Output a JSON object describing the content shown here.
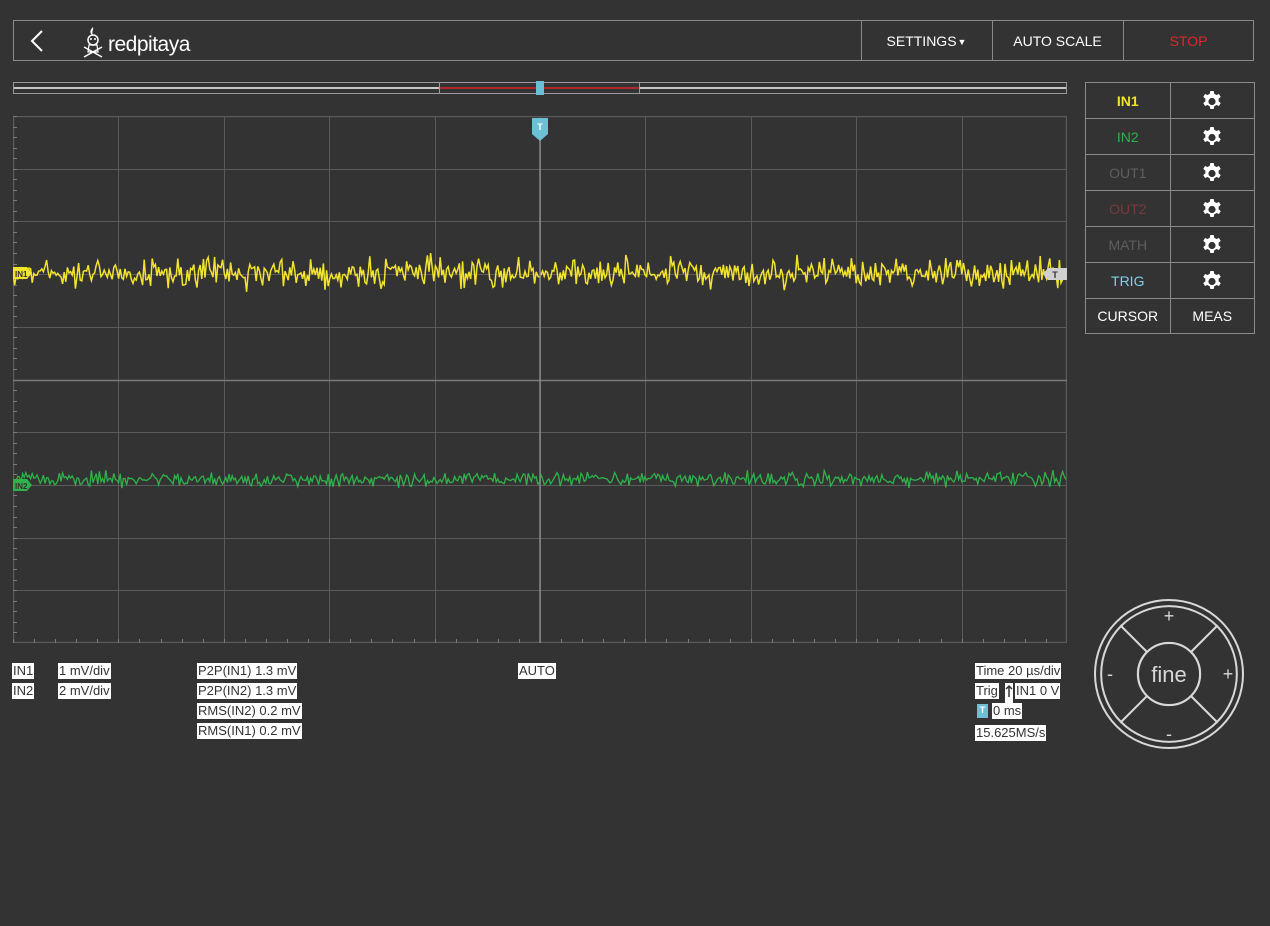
{
  "header": {
    "brand": "redpitaya",
    "settings_label": "SETTINGS",
    "autoscale_label": "AUTO SCALE",
    "stop_label": "STOP"
  },
  "plot": {
    "trigger_marker": "T",
    "in1_label": "IN1",
    "in2_label": "IN2",
    "trig_level_label": "T",
    "colors": {
      "in1": "#f2e32c",
      "in2": "#2fb14b",
      "trigger": "#6cc0d6",
      "grid": "#5a5a5a"
    }
  },
  "panel": {
    "rows": [
      {
        "label": "IN1",
        "color": "#f2e32c",
        "bold": true
      },
      {
        "label": "IN2",
        "color": "#2fb14b",
        "bold": false
      },
      {
        "label": "OUT1",
        "color": "#5e5e5e",
        "bold": false
      },
      {
        "label": "OUT2",
        "color": "#7a3a3a",
        "bold": false
      },
      {
        "label": "MATH",
        "color": "#5e5e5e",
        "bold": false
      },
      {
        "label": "TRIG",
        "color": "#7fd0e6",
        "bold": false
      }
    ],
    "cursor_label": "CURSOR",
    "meas_label": "MEAS"
  },
  "info": {
    "in1": "IN1",
    "in1_scale": "1 mV/div",
    "in2": "IN2",
    "in2_scale": "2 mV/div",
    "p2p_in1": "P2P(IN1) 1.3 mV",
    "p2p_in2": "P2P(IN2) 1.3 mV",
    "rms_in2": "RMS(IN2) 0.2 mV",
    "rms_in1": "RMS(IN1) 0.2 mV",
    "trigger_mode": "AUTO",
    "time": "Time 20 µs/div",
    "trig": "Trig",
    "trig_source": "IN1 0 V",
    "trig_badge": "T",
    "trig_offset": "0 ms",
    "sample_rate": "15.625MS/s"
  },
  "dial": {
    "center_label": "fine",
    "up": "+",
    "down": "-",
    "left": "-",
    "right": "+"
  }
}
